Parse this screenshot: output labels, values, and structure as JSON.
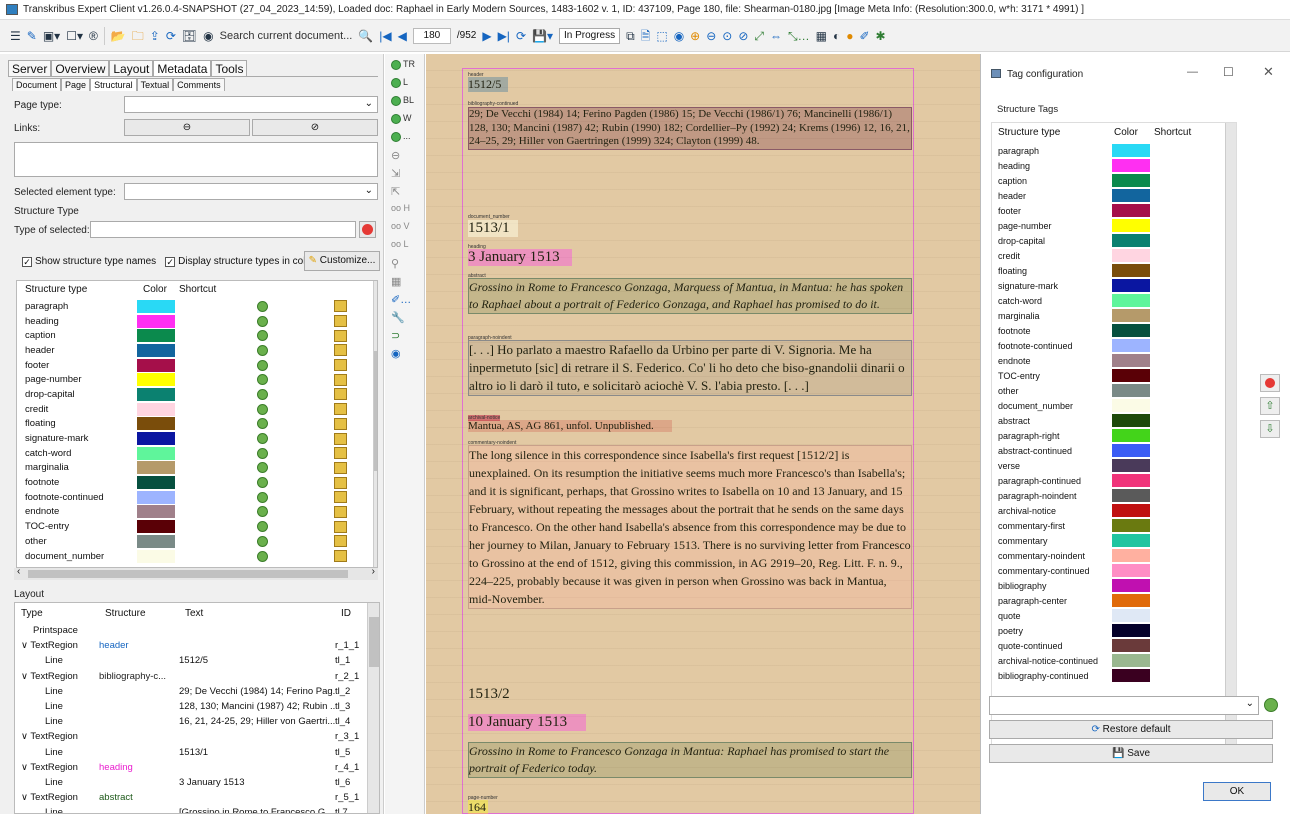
{
  "window_title": "Transkribus Expert Client v1.26.0.4-SNAPSHOT (27_04_2023_14:59), Loaded doc: Raphael in Early Modern Sources, 1483-1602 v. 1, ID: 437109, Page 180, file: Shearman-0180.jpg [Image Meta Info: (Resolution:300.0, w*h: 3171 * 4991) ]",
  "toolbar": {
    "search_doc": "Search current document...",
    "page_current": "180",
    "page_total": "/952",
    "status": "In Progress"
  },
  "left": {
    "tabs": [
      "Server",
      "Overview",
      "Layout",
      "Metadata",
      "Tools"
    ],
    "subtabs": [
      "Document",
      "Page",
      "Structural",
      "Textual",
      "Comments"
    ],
    "page_type_label": "Page type:",
    "links_label": "Links:",
    "selected_element_type_label": "Selected element type:",
    "structure_type_heading": "Structure Type",
    "type_of_selected_label": "Type of selected:",
    "show_names": "Show structure type names",
    "display_colors": "Display structure types in color",
    "customize": "Customize...",
    "col_type": "Structure type",
    "col_color": "Color",
    "col_shortcut": "Shortcut",
    "struct_rows": [
      {
        "name": "paragraph",
        "color": "#29d9f5"
      },
      {
        "name": "heading",
        "color": "#ff2ff2"
      },
      {
        "name": "caption",
        "color": "#0b8a4d"
      },
      {
        "name": "header",
        "color": "#12659e"
      },
      {
        "name": "footer",
        "color": "#a50f4a"
      },
      {
        "name": "page-number",
        "color": "#ffff00"
      },
      {
        "name": "drop-capital",
        "color": "#0b8170"
      },
      {
        "name": "credit",
        "color": "#ffd5e1"
      },
      {
        "name": "floating",
        "color": "#7a4d0b"
      },
      {
        "name": "signature-mark",
        "color": "#0a16a1"
      },
      {
        "name": "catch-word",
        "color": "#5ff59b"
      },
      {
        "name": "marginalia",
        "color": "#b59a6a"
      },
      {
        "name": "footnote",
        "color": "#06503f"
      },
      {
        "name": "footnote-continued",
        "color": "#9db4ff"
      },
      {
        "name": "endnote",
        "color": "#a0808a"
      },
      {
        "name": "TOC-entry",
        "color": "#5a0006"
      },
      {
        "name": "other",
        "color": "#7a8a87"
      },
      {
        "name": "document_number",
        "color": "#fbfbe6"
      }
    ],
    "layout_heading": "Layout",
    "layout_cols": [
      "Type",
      "Structure",
      "Text",
      "ID"
    ],
    "layout_rows": [
      {
        "type": "Printspace",
        "structure": "",
        "text": "",
        "id": "",
        "indent": 1,
        "color": "#222"
      },
      {
        "type": "∨ TextRegion",
        "structure": "header",
        "text": "",
        "id": "r_1_1",
        "indent": 0,
        "color": "#1565c0"
      },
      {
        "type": "Line",
        "structure": "",
        "text": "1512/5",
        "id": "tl_1",
        "indent": 2,
        "color": "#222"
      },
      {
        "type": "∨ TextRegion",
        "structure": "bibliography-c...",
        "text": "",
        "id": "r_2_1",
        "indent": 0,
        "color": "#222"
      },
      {
        "type": "Line",
        "structure": "",
        "text": "29; De Vecchi (1984) 14; Ferino Pag...",
        "id": "tl_2",
        "indent": 2,
        "color": "#222"
      },
      {
        "type": "Line",
        "structure": "",
        "text": "128, 130; Mancini (1987) 42; Rubin ...",
        "id": "tl_3",
        "indent": 2,
        "color": "#222"
      },
      {
        "type": "Line",
        "structure": "",
        "text": "16, 21, 24-25, 29; Hiller von Gaertri...",
        "id": "tl_4",
        "indent": 2,
        "color": "#222"
      },
      {
        "type": "∨ TextRegion",
        "structure": "",
        "text": "",
        "id": "r_3_1",
        "indent": 0,
        "color": "#222"
      },
      {
        "type": "Line",
        "structure": "",
        "text": "1513/1",
        "id": "tl_5",
        "indent": 2,
        "color": "#222"
      },
      {
        "type": "∨ TextRegion",
        "structure": "heading",
        "text": "",
        "id": "r_4_1",
        "indent": 0,
        "color": "#e91ecf"
      },
      {
        "type": "Line",
        "structure": "",
        "text": "3 January 1513",
        "id": "tl_6",
        "indent": 2,
        "color": "#222"
      },
      {
        "type": "∨ TextRegion",
        "structure": "abstract",
        "text": "",
        "id": "r_5_1",
        "indent": 0,
        "color": "#1e5a1a"
      },
      {
        "type": "Line",
        "structure": "",
        "text": "[Grossino in Rome to Francesco G...",
        "id": "tl 7",
        "indent": 2,
        "color": "#222"
      }
    ]
  },
  "vtool": [
    "TR",
    "L",
    "BL",
    "W",
    "..."
  ],
  "doc": {
    "region_labels": [
      "header",
      "bibliography-continued",
      "document_number",
      "heading",
      "abstract",
      "paragraph-noindent",
      "archival-notice",
      "commentary-noindent",
      "page-number"
    ],
    "header": "1512/5",
    "biblio": "29; De Vecchi (1984) 14; Ferino Pagden (1986) 15; De Vecchi (1986/1) 76; Mancinelli (1986/1) 128, 130; Mancini (1987) 42; Rubin (1990) 182; Cordellier–Py (1992) 24; Krems (1996) 12, 16, 21, 24–25, 29; Hiller von Gaertringen (1999) 324; Clayton (1999) 48.",
    "docnum": "1513/1",
    "heading": "3 January 1513",
    "abstract": "Grossino in Rome to Francesco Gonzaga, Marquess of Mantua, in Mantua: he has spoken to Raphael about a portrait of Federico Gonzaga, and Raphael has promised to do it.",
    "letter": "[. . .] Ho parlato a maestro Rafaello da Urbino per parte di V. Signoria. Me ha inpermetuto [sic] di retrare il S. Federico. Co' li ho deto che biso-gnandolii dinarii o altro io li darò il tuto, e solicitarò aciochè V. S. l'abia presto. [. . .]",
    "archival": "Mantua, AS, AG 861, unfol. Unpublished.",
    "commentary": "The long silence in this correspondence since Isabella's first request [1512/2] is unexplained. On its resumption the initiative seems much more Francesco's than Isabella's; and it is significant, perhaps, that Grossino writes to Isabella on 10 and 13 January, and 15 February, without repeating the messages about the portrait that he sends on the same days to Francesco. On the other hand Isabella's absence from this correspondence may be due to her journey to Milan, January to February 1513. There is no surviving letter from Francesco to Grossino at the end of 1512, giving this commission, in AG 2919–20, Reg. Litt. F. n. 9., 224–225, probably because it was given in person when Grossino was back in Mantua, mid-November.",
    "docnum2": "1513/2",
    "heading2": "10 January 1513",
    "abstract2": "Grossino in Rome to Francesco Gonzaga in Mantua: Raphael has promised to start the portrait of Federico today.",
    "pagenum": "164"
  },
  "dialog": {
    "title": "Tag configuration",
    "section": "Structure Tags",
    "col_type": "Structure type",
    "col_color": "Color",
    "col_shortcut": "Shortcut",
    "rows": [
      {
        "name": "paragraph",
        "color": "#29d9f5"
      },
      {
        "name": "heading",
        "color": "#ff2ff2"
      },
      {
        "name": "caption",
        "color": "#0b8a4d"
      },
      {
        "name": "header",
        "color": "#12659e"
      },
      {
        "name": "footer",
        "color": "#a50f4a"
      },
      {
        "name": "page-number",
        "color": "#ffff00"
      },
      {
        "name": "drop-capital",
        "color": "#0b8170"
      },
      {
        "name": "credit",
        "color": "#ffd5e1"
      },
      {
        "name": "floating",
        "color": "#7a4d0b"
      },
      {
        "name": "signature-mark",
        "color": "#0a16a1"
      },
      {
        "name": "catch-word",
        "color": "#5ff59b"
      },
      {
        "name": "marginalia",
        "color": "#b59a6a"
      },
      {
        "name": "footnote",
        "color": "#06503f"
      },
      {
        "name": "footnote-continued",
        "color": "#9db4ff"
      },
      {
        "name": "endnote",
        "color": "#a0808a"
      },
      {
        "name": "TOC-entry",
        "color": "#5a0006"
      },
      {
        "name": "other",
        "color": "#7a8a87"
      },
      {
        "name": "document_number",
        "color": "#fbfbe6"
      },
      {
        "name": "abstract",
        "color": "#1e4a0a"
      },
      {
        "name": "paragraph-right",
        "color": "#43d41a"
      },
      {
        "name": "abstract-continued",
        "color": "#3b5cf5"
      },
      {
        "name": "verse",
        "color": "#4a3a5a"
      },
      {
        "name": "paragraph-continued",
        "color": "#f0347a"
      },
      {
        "name": "paragraph-noindent",
        "color": "#5a5a5a"
      },
      {
        "name": "archival-notice",
        "color": "#c01010"
      },
      {
        "name": "commentary-first",
        "color": "#6a7a10"
      },
      {
        "name": "commentary",
        "color": "#20c5a0"
      },
      {
        "name": "commentary-noindent",
        "color": "#ffb0a0"
      },
      {
        "name": "commentary-continued",
        "color": "#ff8ec5"
      },
      {
        "name": "bibliography",
        "color": "#c010b0"
      },
      {
        "name": "paragraph-center",
        "color": "#e06a0a"
      },
      {
        "name": "quote",
        "color": "#dfe8f5"
      },
      {
        "name": "poetry",
        "color": "#04002a"
      },
      {
        "name": "quote-continued",
        "color": "#6a3a3a"
      },
      {
        "name": "archival-notice-continued",
        "color": "#9ab890"
      },
      {
        "name": "bibliography-continued",
        "color": "#3a0020"
      }
    ],
    "restore": "Restore default",
    "save": "Save",
    "ok": "OK"
  }
}
